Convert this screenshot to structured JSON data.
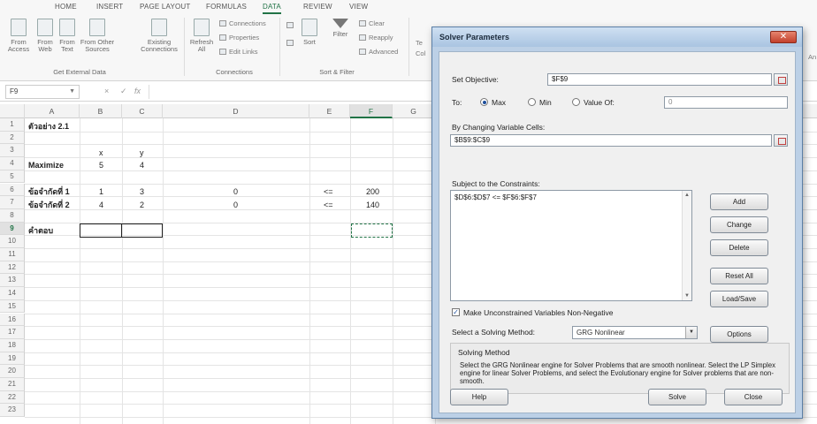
{
  "ribbon": {
    "tabs": [
      "HOME",
      "INSERT",
      "PAGE LAYOUT",
      "FORMULAS",
      "DATA",
      "REVIEW",
      "VIEW"
    ],
    "active_tab": "DATA",
    "get_external": {
      "from_access": "From Access",
      "from_web": "From Web",
      "from_text": "From Text",
      "from_other": "From Other Sources",
      "existing": "Existing Connections",
      "group_label": "Get External Data"
    },
    "connections": {
      "refresh_all": "Refresh All",
      "connections": "Connections",
      "properties": "Properties",
      "edit_links": "Edit Links",
      "group_label": "Connections"
    },
    "sort_filter": {
      "sort": "Sort",
      "filter": "Filter",
      "clear": "Clear",
      "reapply": "Reapply",
      "advanced": "Advanced",
      "group_label": "Sort & Filter"
    },
    "text_to_col": "Te",
    "text_to_col2": "Col",
    "partial_right": "An"
  },
  "formula_bar": {
    "name_box": "F9",
    "cancel": "×",
    "enter": "✓",
    "fx": "fx"
  },
  "sheet": {
    "columns": [
      "A",
      "B",
      "C",
      "D",
      "E",
      "F",
      "G"
    ],
    "rows": [
      "1",
      "2",
      "3",
      "4",
      "5",
      "6",
      "7",
      "8",
      "9",
      "10",
      "11",
      "12",
      "13",
      "14",
      "15",
      "16",
      "17",
      "18",
      "19",
      "20",
      "21",
      "22",
      "23"
    ],
    "cells": {
      "a1": "ตัวอย่าง 2.1",
      "b3": "x",
      "c3": "y",
      "a4": "Maximize",
      "b4": "5",
      "c4": "4",
      "a6": "ข้อจำกัดที่ 1",
      "b6": "1",
      "c6": "3",
      "d6": "0",
      "e6": "<=",
      "f6": "200",
      "a7": "ข้อจำกัดที่ 2",
      "b7": "4",
      "c7": "2",
      "d7": "0",
      "e7": "<=",
      "f7": "140",
      "a9": "คำตอบ"
    }
  },
  "solver": {
    "title": "Solver Parameters",
    "close": "✕",
    "set_objective_label": "Set Objective:",
    "objective_value": "$F$9",
    "to_label": "To:",
    "max_label": "Max",
    "min_label": "Min",
    "valueof_label": "Value Of:",
    "valueof_value": "0",
    "selected_goal": "Max",
    "changing_label": "By Changing Variable Cells:",
    "changing_value": "$B$9:$C$9",
    "subject_label": "Subject to the Constraints:",
    "constraints": [
      "$D$6:$D$7 <= $F$6:$F$7"
    ],
    "buttons": {
      "add": "Add",
      "change": "Change",
      "delete": "Delete",
      "reset": "Reset All",
      "loadsave": "Load/Save",
      "options": "Options",
      "help": "Help",
      "solve": "Solve",
      "close": "Close"
    },
    "nonneg_label": "Make Unconstrained Variables Non-Negative",
    "nonneg_checked": true,
    "method_label": "Select a Solving Method:",
    "method_value": "GRG Nonlinear",
    "solving_method_title": "Solving Method",
    "solving_method_desc": "Select the GRG Nonlinear engine for Solver Problems that are smooth nonlinear. Select the LP Simplex engine for linear Solver Problems, and select the Evolutionary engine for Solver problems that are non-smooth."
  }
}
